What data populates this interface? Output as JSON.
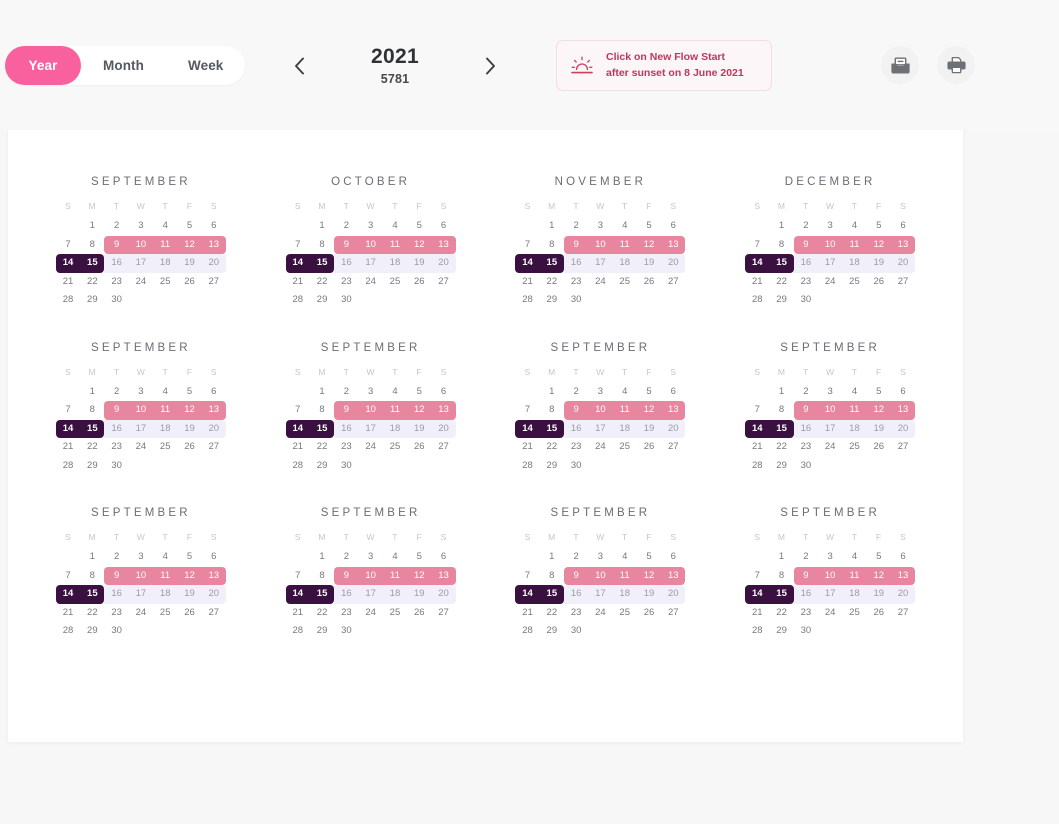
{
  "toolbar": {
    "views": [
      {
        "label": "Year",
        "active": true
      },
      {
        "label": "Month",
        "active": false
      },
      {
        "label": "Week",
        "active": false
      }
    ],
    "prev_icon": "chevron-left-icon",
    "next_icon": "chevron-right-icon",
    "year": "2021",
    "year_alt": "5781",
    "callout": {
      "icon": "sunset-icon",
      "line1": "Click on New Flow Start",
      "line2": "after sunset on 8 June 2021"
    },
    "actions": [
      {
        "name": "mail-button",
        "icon": "envelope-icon"
      },
      {
        "name": "print-button",
        "icon": "printer-icon"
      }
    ]
  },
  "colors": {
    "accent_pink": "#f8619e",
    "band_pink": "#e8869f",
    "band_dark": "#3a1040",
    "band_lavender": "#f0effa",
    "callout_text": "#c2365b",
    "page_bg": "#f7f7f7",
    "card_bg": "#ffffff"
  },
  "calendar": {
    "weekdays": [
      "S",
      "M",
      "T",
      "W",
      "T",
      "F",
      "S"
    ],
    "months": [
      {
        "name": "SEPTEMBER"
      },
      {
        "name": "OCTOBER"
      },
      {
        "name": "NOVEMBER"
      },
      {
        "name": "DECEMBER"
      },
      {
        "name": "SEPTEMBER"
      },
      {
        "name": "SEPTEMBER"
      },
      {
        "name": "SEPTEMBER"
      },
      {
        "name": "SEPTEMBER"
      },
      {
        "name": "SEPTEMBER"
      },
      {
        "name": "SEPTEMBER"
      },
      {
        "name": "SEPTEMBER"
      },
      {
        "name": "SEPTEMBER"
      }
    ],
    "grid": [
      [
        "",
        "1",
        "2",
        "3",
        "4",
        "5",
        "6"
      ],
      [
        "7",
        "8",
        "9",
        "10",
        "11",
        "12",
        "13"
      ],
      [
        "14",
        "15",
        "16",
        "17",
        "18",
        "19",
        "20"
      ],
      [
        "21",
        "22",
        "23",
        "24",
        "25",
        "26",
        "27"
      ],
      [
        "28",
        "29",
        "30",
        "",
        "",
        "",
        ""
      ]
    ],
    "highlights": {
      "pink": {
        "days": [
          "9",
          "10",
          "11",
          "12",
          "13"
        ],
        "start": "9",
        "end": "13"
      },
      "dark": {
        "days": [
          "14",
          "15"
        ],
        "start": "14",
        "end": "15"
      },
      "lavender": {
        "days": [
          "16",
          "17",
          "18",
          "19",
          "20"
        ],
        "start": "16",
        "end": "20"
      }
    }
  }
}
